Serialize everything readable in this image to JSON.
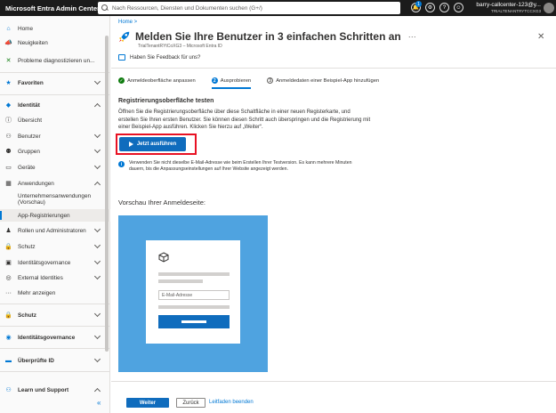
{
  "topbar": {
    "brand": "Microsoft Entra Admin Center",
    "search_placeholder": "Nach Ressourcen, Diensten und Dokumenten suchen (G+/)",
    "notifications_count": "1",
    "account_name": "barry-callcenter-123@y...",
    "account_tenant": "TRIALTENANTRYTCCXG3"
  },
  "sidebar": {
    "items": [
      {
        "label": "Home"
      },
      {
        "label": "Neuigkeiten"
      },
      {
        "label": "Probleme diagnostizieren un..."
      },
      {
        "label": "Favoriten"
      },
      {
        "label": "Identität"
      },
      {
        "label": "Übersicht"
      },
      {
        "label": "Benutzer"
      },
      {
        "label": "Gruppen"
      },
      {
        "label": "Geräte"
      },
      {
        "label": "Anwendungen"
      },
      {
        "label": "Unternehmensanwendungen (Vorschau)"
      },
      {
        "label": "App-Registrierungen"
      },
      {
        "label": "Rollen und Administratoren"
      },
      {
        "label": "Schutz"
      },
      {
        "label": "Identitätsgovernance"
      },
      {
        "label": "External Identities"
      },
      {
        "label": "Mehr anzeigen"
      },
      {
        "label": "Schutz"
      },
      {
        "label": "Identitätsgovernance"
      },
      {
        "label": "Überprüfte ID"
      },
      {
        "label": "Learn und Support"
      }
    ],
    "collapse_icon": "«"
  },
  "main": {
    "breadcrumb": "Home >",
    "title": "Melden Sie Ihre Benutzer in 3 einfachen Schritten an",
    "ellipsis": "···",
    "subtitle": "TrialTenantRYtCoXG3 – Microsoft Entra ID",
    "feedback": "Haben Sie Feedback für uns?",
    "steps": [
      {
        "label": "Anmeldeoberfläche anpassen",
        "state": "done",
        "marker": "✓"
      },
      {
        "label": "Ausprobieren",
        "state": "current",
        "marker": "2"
      },
      {
        "label": "Anmeldedaten einer Beispiel-App hinzufügen",
        "state": "pending",
        "marker": "3"
      }
    ],
    "section_heading": "Registrierungsoberfläche testen",
    "description": "Öffnen Sie die Registrierungsoberfläche über diese Schaltfläche in einer neuen Registerkarte, und erstellen Sie Ihren ersten Benutzer. Sie können diesen Schritt auch überspringen und die Registrierung mit einer Beispiel-App ausführen. Klicken Sie hierzu auf „Weiter“.",
    "run_button": "Jetzt ausführen",
    "info_text": "Verwenden Sie nicht dieselbe E-Mail-Adresse wie beim Erstellen Ihrer Testversion. Es kann mehrere Minuten dauern, bis die Anpassungseinstellungen auf Ihrer Website angezeigt werden.",
    "preview_heading": "Vorschau Ihrer Anmeldeseite:",
    "preview_email_placeholder": "E-Mail-Adresse",
    "next_button": "Weiter",
    "back_button": "Zurück",
    "guide_link": "Leitfaden beenden"
  },
  "colors": {
    "accent": "#0f6cbd",
    "highlight": "#e81123",
    "success": "#107c10",
    "preview_bg": "#4fa3e0"
  }
}
